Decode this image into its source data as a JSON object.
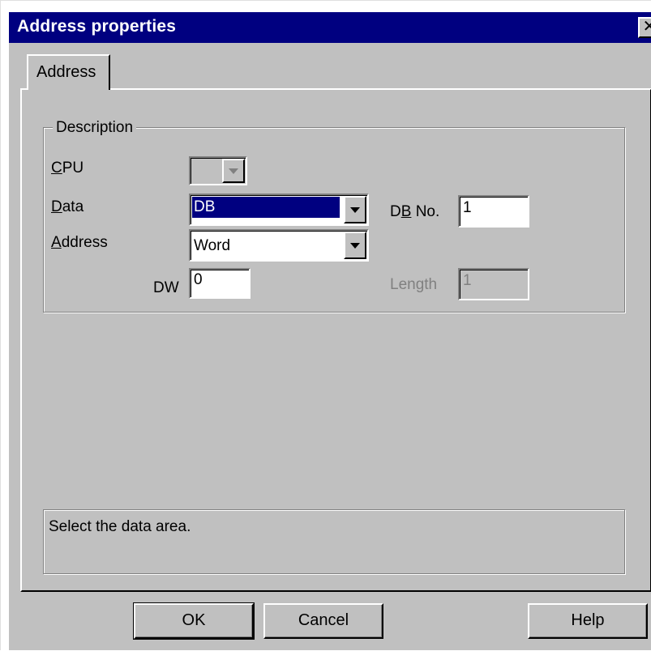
{
  "window": {
    "title": "Address properties",
    "close_glyph": "✕"
  },
  "tabs": [
    {
      "label": "Address"
    }
  ],
  "description_group": {
    "label": "Description",
    "cpu": {
      "label_prefix": "",
      "label_accel": "C",
      "label_rest": "PU",
      "value": ""
    },
    "data": {
      "label_accel": "D",
      "label_rest": "ata",
      "value": "DB"
    },
    "address": {
      "label_accel": "A",
      "label_rest": "ddress",
      "value": "Word"
    },
    "db_no": {
      "label_prefix": "D",
      "label_accel": "B",
      "label_rest": " No.",
      "value": "1"
    },
    "dw": {
      "label": "DW",
      "value": "0"
    },
    "length": {
      "label": "Length",
      "value": "1"
    }
  },
  "status": {
    "text": "Select the data area."
  },
  "buttons": {
    "ok": "OK",
    "cancel": "Cancel",
    "help": "Help"
  },
  "colors": {
    "titlebar": "#000080",
    "face": "#c0c0c0",
    "selection": "#000080"
  },
  "icons": {
    "close": "close-icon",
    "dropdown": "chevron-down-icon"
  }
}
